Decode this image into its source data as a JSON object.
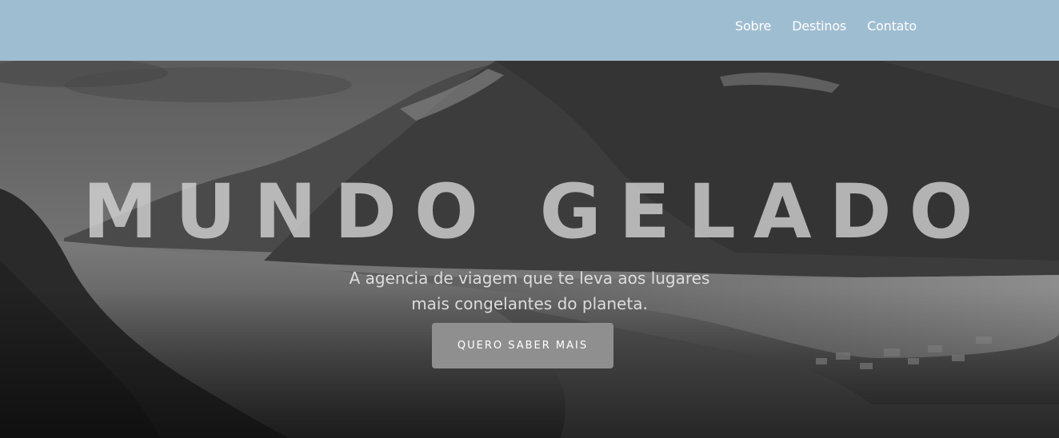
{
  "nav": {
    "items": [
      {
        "label": "Sobre"
      },
      {
        "label": "Destinos"
      },
      {
        "label": "Contato"
      }
    ]
  },
  "hero": {
    "title": "MUNDO GELADO",
    "subtitle_line1": "A agencia de viagem que te leva aos lugares",
    "subtitle_line2": "mais congelantes do planeta.",
    "cta_label": "QUERO SABER MAIS",
    "background_image": "grayscale-frozen-lake-mountains-photo"
  },
  "colors": {
    "nav_background": "#9fbdd1",
    "nav_text": "#ffffff",
    "cta_background": "#8f8f8f"
  }
}
